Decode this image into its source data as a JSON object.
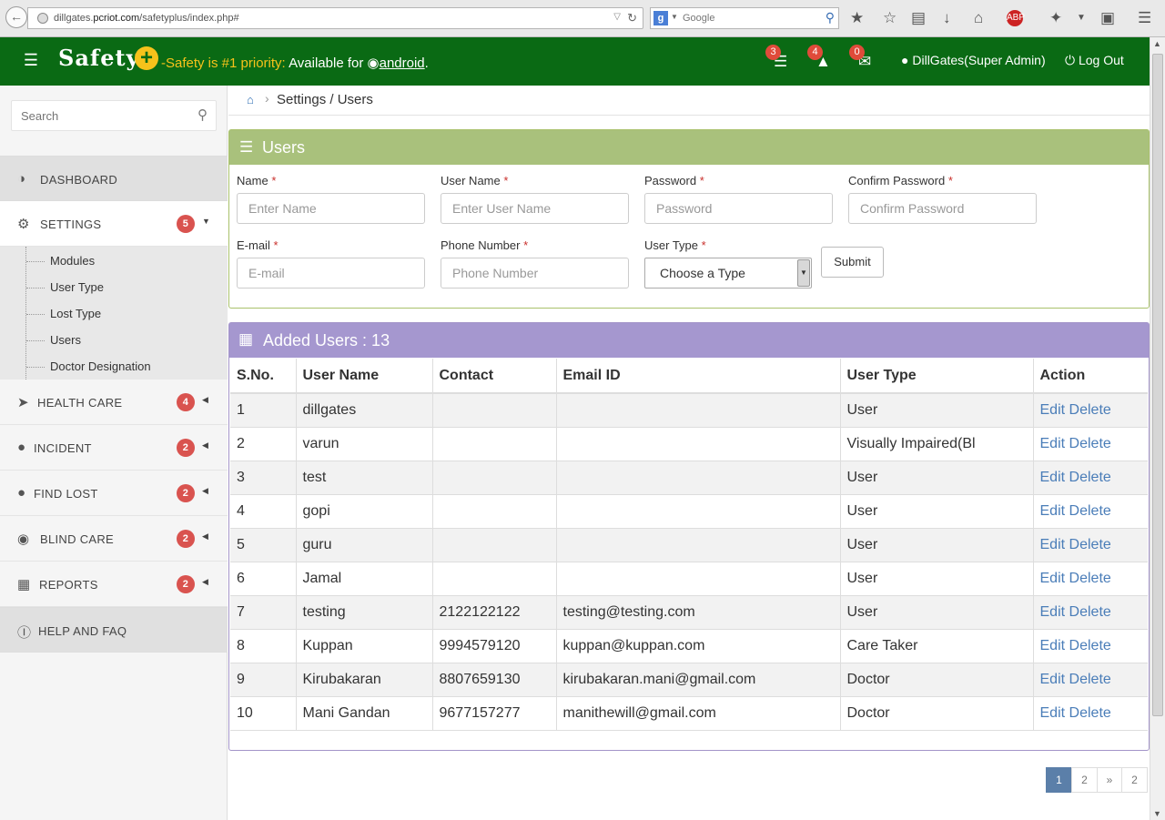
{
  "browser": {
    "url_prefix": "dillgates.",
    "url_domain": "pcriot.com",
    "url_path": "/safetyplus/index.php#",
    "search_engine": "Google",
    "search_placeholder": "Google"
  },
  "header": {
    "logo": "Safety",
    "tagline_highlight": "-Safety is #1 priority:",
    "tagline_text": "Available for",
    "tagline_link": "android",
    "tagline_end": ".",
    "tasks_count": "3",
    "notifications_count": "4",
    "messages_count": "0",
    "user": "DillGates(Super Admin)",
    "logout": "Log Out",
    "brand_color": "#0a6a14",
    "accent_color": "#f6c21b"
  },
  "sidebar": {
    "search_placeholder": "Search",
    "menu": [
      {
        "label": "DASHBOARD",
        "icon": "dashboard-icon"
      },
      {
        "label": "SETTINGS",
        "icon": "gears-icon",
        "badge": "5"
      },
      {
        "label": "HEALTH CARE",
        "icon": "location-arrow-icon",
        "badge": "4"
      },
      {
        "label": "INCIDENT",
        "icon": "map-marker-icon",
        "badge": "2"
      },
      {
        "label": "FIND LOST",
        "icon": "map-marker-icon",
        "badge": "2"
      },
      {
        "label": "BLIND CARE",
        "icon": "eye-slash-icon",
        "badge": "2"
      },
      {
        "label": "REPORTS",
        "icon": "table-icon",
        "badge": "2"
      },
      {
        "label": "HELP AND FAQ",
        "icon": "info-circle-icon"
      }
    ],
    "settings_submenu": [
      "Modules",
      "User Type",
      "Lost Type",
      "Users",
      "Doctor Designation"
    ]
  },
  "breadcrumb": {
    "text": "Settings / Users"
  },
  "users_form": {
    "title": "Users",
    "name_label": "Name",
    "name_placeholder": "Enter Name",
    "username_label": "User Name",
    "username_placeholder": "Enter User Name",
    "password_label": "Password",
    "password_placeholder": "Password",
    "confirm_label": "Confirm Password",
    "confirm_placeholder": "Confirm Password",
    "email_label": "E-mail",
    "email_placeholder": "E-mail",
    "phone_label": "Phone Number",
    "phone_placeholder": "Phone Number",
    "usertype_label": "User Type",
    "usertype_selected": "Choose a Type",
    "required_mark": "*",
    "submit": "Submit"
  },
  "added_users": {
    "title": "Added Users :  13",
    "columns": [
      "S.No.",
      "User Name",
      "Contact",
      "Email ID",
      "User Type",
      "Action"
    ],
    "rows": [
      [
        "1",
        "dillgates",
        "",
        "",
        "User"
      ],
      [
        "2",
        "varun",
        "",
        "",
        "Visually Impaired(Bl"
      ],
      [
        "3",
        "test",
        "",
        "",
        "User"
      ],
      [
        "4",
        "gopi",
        "",
        "",
        "User"
      ],
      [
        "5",
        "guru",
        "",
        "",
        "User"
      ],
      [
        "6",
        "Jamal",
        "",
        "",
        "User"
      ],
      [
        "7",
        "testing",
        "2122122122",
        "testing@testing.com",
        "User"
      ],
      [
        "8",
        "Kuppan",
        "9994579120",
        "kuppan@kuppan.com",
        "Care Taker"
      ],
      [
        "9",
        "Kirubakaran",
        "8807659130",
        "kirubakaran.mani@gmail.com",
        "Doctor"
      ],
      [
        "10",
        "Mani Gandan",
        "9677157277",
        "manithewill@gmail.com",
        "Doctor"
      ]
    ],
    "edit_label": "Edit",
    "delete_label": "Delete"
  },
  "pagination": {
    "pages": [
      "1",
      "2",
      "»",
      "2"
    ],
    "active": "1"
  }
}
